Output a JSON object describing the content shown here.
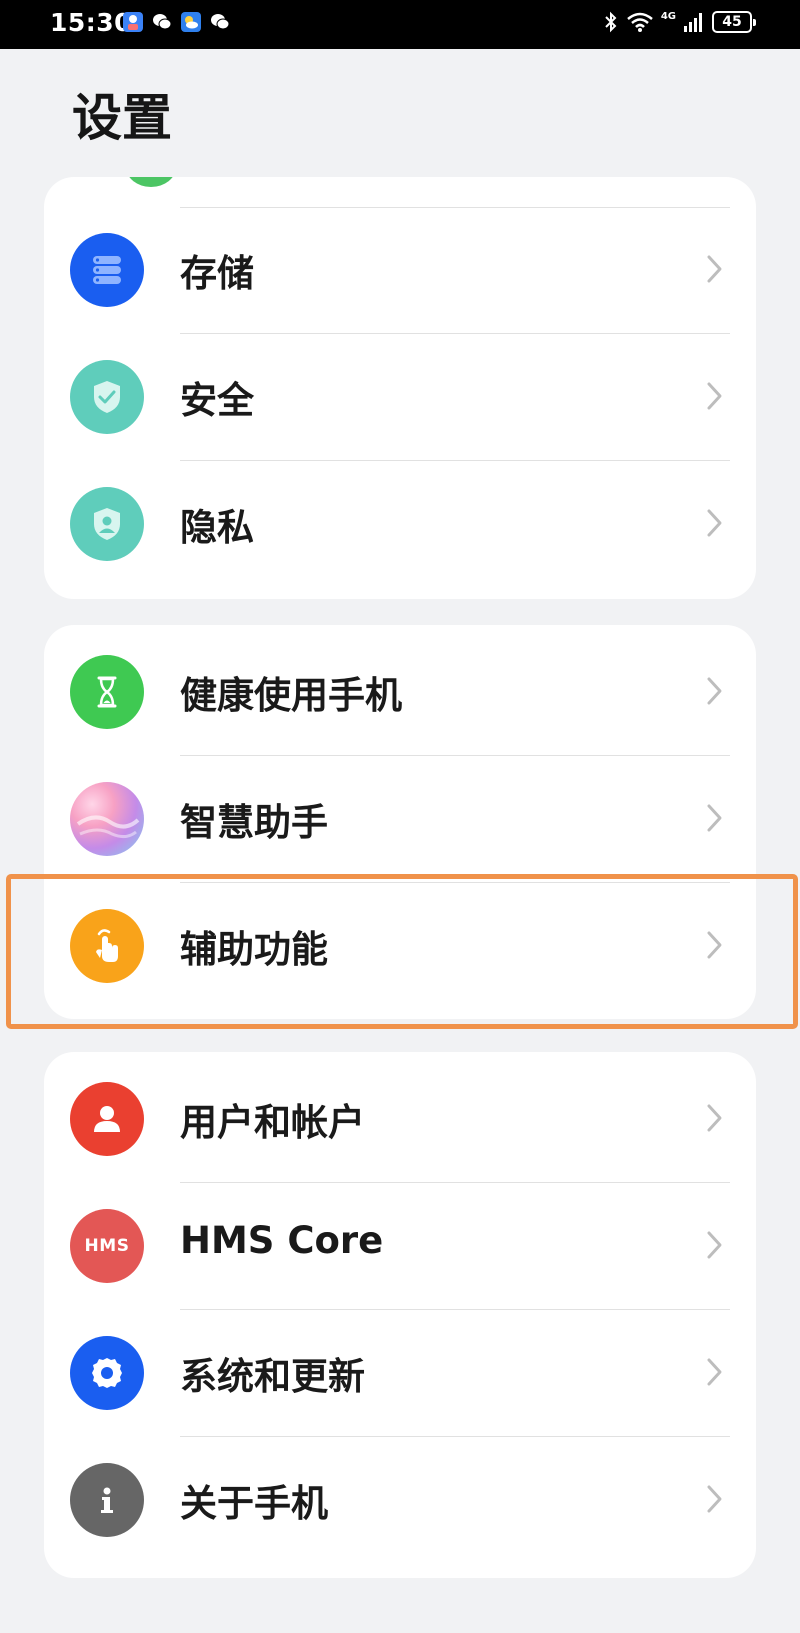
{
  "status_bar": {
    "time": "15:30",
    "network_label": "4G",
    "battery_level": "45",
    "left_icons": [
      "app-notification-icon",
      "wechat-icon",
      "weather-icon",
      "wechat-icon"
    ],
    "right_icons": [
      "bluetooth-icon",
      "wifi-icon",
      "signal-icon",
      "battery-icon"
    ]
  },
  "page": {
    "title": "设置"
  },
  "groups": [
    {
      "items": [
        {
          "label": "存储",
          "icon": "storage-icon",
          "color": "#1a5ef0"
        },
        {
          "label": "安全",
          "icon": "security-shield-icon",
          "color": "#5fcdbb"
        },
        {
          "label": "隐私",
          "icon": "privacy-shield-icon",
          "color": "#5fcdbb"
        }
      ]
    },
    {
      "items": [
        {
          "label": "健康使用手机",
          "icon": "hourglass-icon",
          "color": "#3fc952"
        },
        {
          "label": "智慧助手",
          "icon": "smart-assistant-icon",
          "color": "#c48be8"
        },
        {
          "label": "辅助功能",
          "icon": "accessibility-hand-icon",
          "color": "#f9a31a"
        }
      ]
    },
    {
      "items": [
        {
          "label": "用户和帐户",
          "icon": "user-icon",
          "color": "#ea4030"
        },
        {
          "label": "HMS Core",
          "icon": "hms-core-icon",
          "color": "#e35755"
        },
        {
          "label": "系统和更新",
          "icon": "gear-icon",
          "color": "#1a5ef0"
        },
        {
          "label": "关于手机",
          "icon": "info-icon",
          "color": "#666666"
        }
      ]
    }
  ],
  "hms_icon_text": "HMS",
  "highlight": {
    "color": "#f0924a",
    "target": "辅助功能"
  }
}
